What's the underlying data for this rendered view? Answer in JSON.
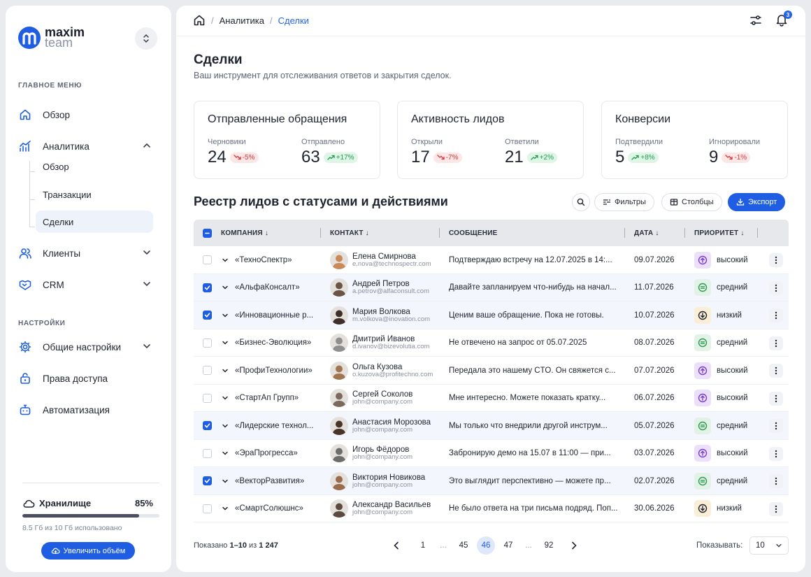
{
  "brand": {
    "name_line1": "maxim",
    "name_line2": "team",
    "color": "#1f5ee3"
  },
  "sidebar": {
    "main_menu_label": "ГЛАВНОЕ МЕНЮ",
    "settings_label": "НАСТРОЙКИ",
    "items": [
      {
        "label": "Обзор",
        "icon": "home-icon"
      },
      {
        "label": "Аналитика",
        "icon": "analytics-icon",
        "expanded": true
      },
      {
        "label": "Клиенты",
        "icon": "users-icon"
      },
      {
        "label": "CRM",
        "icon": "handshake-icon"
      }
    ],
    "analytics_sub": [
      {
        "label": "Обзор"
      },
      {
        "label": "Транзакции"
      },
      {
        "label": "Сделки",
        "active": true
      }
    ],
    "settings_items": [
      {
        "label": "Общие настройки",
        "icon": "gear-icon"
      },
      {
        "label": "Права доступа",
        "icon": "key-icon"
      },
      {
        "label": "Автоматизация",
        "icon": "robot-icon"
      }
    ],
    "storage": {
      "title": "Хранилище",
      "percent_label": "85%",
      "percent": 85,
      "note": "8.5 Гб из 10 Гб использовано",
      "button": "Увеличить объём"
    }
  },
  "breadcrumb": {
    "items": [
      "Аналитика",
      "Сделки"
    ]
  },
  "notifications_count": "3",
  "page": {
    "title": "Сделки",
    "subtitle": "Ваш инструмент для отслеживания ответов и закрытия сделок."
  },
  "stats": [
    {
      "title": "Отправленные обращения",
      "metrics": [
        {
          "label": "Черновики",
          "value": "24",
          "delta": "-5%",
          "trend": "down"
        },
        {
          "label": "Отправлено",
          "value": "63",
          "delta": "+17%",
          "trend": "up"
        }
      ]
    },
    {
      "title": "Активность лидов",
      "metrics": [
        {
          "label": "Открыли",
          "value": "17",
          "delta": "-7%",
          "trend": "down"
        },
        {
          "label": "Ответили",
          "value": "21",
          "delta": "+2%",
          "trend": "up"
        }
      ]
    },
    {
      "title": "Конверсии",
      "metrics": [
        {
          "label": "Подтвердили",
          "value": "5",
          "delta": "+8%",
          "trend": "up"
        },
        {
          "label": "Игнорировали",
          "value": "9",
          "delta": "-1%",
          "trend": "down"
        }
      ]
    }
  ],
  "registry": {
    "title": "Реестр лидов с статусами и действиями",
    "filters": "Фильтры",
    "columns_btn": "Столбцы",
    "export": "Экспорт",
    "headers": {
      "company": "КОМПАНИЯ",
      "contact": "КОНТАКТ",
      "message": "СООБЩЕНИЕ",
      "date": "ДАТА",
      "priority": "ПРИОРИТЕТ"
    },
    "rows": [
      {
        "checked": false,
        "company": "«ТехноСпектр»",
        "name": "Елена Смирнова",
        "email": "e.nova@technospectr.com",
        "message": "Подтверждаю встречу на 12.07.2025 в 14:...",
        "date": "09.07.2026",
        "priority": "высокий",
        "level": "high"
      },
      {
        "checked": true,
        "company": "«АльфаКонсалт»",
        "name": "Андрей Петров",
        "email": "a.petrov@alfaconsult.com",
        "message": "Давайте запланируем что-нибудь на начал...",
        "date": "11.07.2026",
        "priority": "средний",
        "level": "mid"
      },
      {
        "checked": true,
        "company": "«Инновационные р...",
        "name": "Мария Волкова",
        "email": "m.volkova@inovation.com",
        "message": "Ценим ваше обращение. Пока не готовы.",
        "date": "10.07.2026",
        "priority": "низкий",
        "level": "low"
      },
      {
        "checked": false,
        "company": "«Бизнес-Эволюция»",
        "name": "Дмитрий Иванов",
        "email": "d.ivanov@bizevolutia.com",
        "message": "Не отвечено на запрос от 05.07.2025",
        "date": "08.07.2026",
        "priority": "средний",
        "level": "mid"
      },
      {
        "checked": false,
        "company": "«ПрофиТехнологии»",
        "name": "Ольга Кузова",
        "email": "o.kuzova@profitechno.com",
        "message": "Передала это нашему CTO. Он свяжется с...",
        "date": "07.07.2026",
        "priority": "высокий",
        "level": "high"
      },
      {
        "checked": false,
        "company": "«СтартАп Групп»",
        "name": "Сергей Соколов",
        "email": "john@company.com",
        "message": "Мне интересно. Можете показать кратку...",
        "date": "06.07.2026",
        "priority": "высокий",
        "level": "high"
      },
      {
        "checked": true,
        "company": "«Лидерские технол...",
        "name": "Анастасия Морозова",
        "email": "john@company.com",
        "message": "Мы только что внедрили другой инструм...",
        "date": "05.07.2026",
        "priority": "средний",
        "level": "mid"
      },
      {
        "checked": false,
        "company": "«ЭраПрогресса»",
        "name": "Игорь Фёдоров",
        "email": "john@company.com",
        "message": "Забронирую демо на 15.07 в 11:00 — при...",
        "date": "03.07.2026",
        "priority": "высокий",
        "level": "high"
      },
      {
        "checked": true,
        "company": "«ВекторРазвития»",
        "name": "Виктория Новикова",
        "email": "john@company.com",
        "message": "Это выглядит перспективно — можете пр...",
        "date": "02.07.2026",
        "priority": "средний",
        "level": "mid"
      },
      {
        "checked": false,
        "company": "«СмартСолюшнс»",
        "name": "Александр Васильев",
        "email": "john@company.com",
        "message": "Не было ответа на три письма подряд. Поп...",
        "date": "30.06.2026",
        "priority": "низкий",
        "level": "low"
      }
    ]
  },
  "footer": {
    "shown_prefix": "Показано ",
    "shown_range": "1–10",
    "shown_mid": " из ",
    "shown_total": "1 247",
    "pages": [
      "1",
      "...",
      "45",
      "46",
      "47",
      "...",
      "92"
    ],
    "current_page": "46",
    "per_page_label": "Показывать:",
    "per_page_value": "10"
  },
  "colors": {
    "accent": "#1f5ee3",
    "up": "#239b52",
    "down": "#d33b3b",
    "high": "#7b3fc9",
    "mid": "#2f9a52",
    "low": "#1f2430"
  }
}
